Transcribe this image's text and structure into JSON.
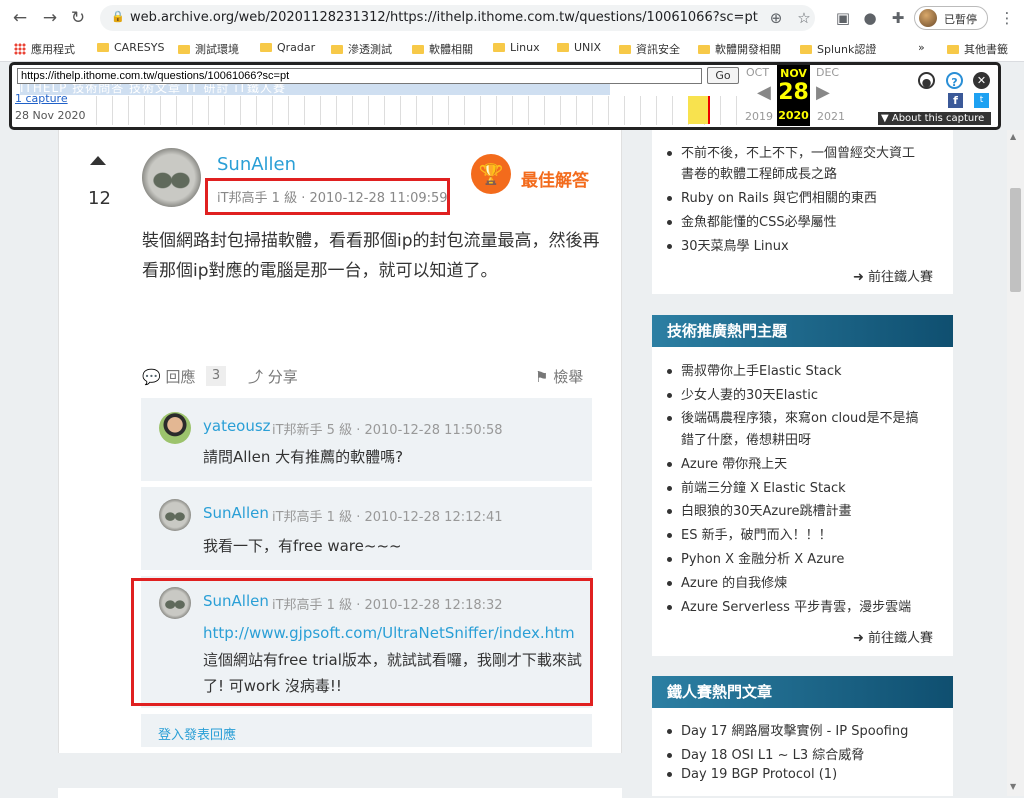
{
  "browser": {
    "url": "web.archive.org/web/20201128231312/https://ithelp.ithome.com.tw/questions/10061066?sc=pt",
    "profile_label": "已暫停"
  },
  "bookmarks": [
    "應用程式",
    "CARESYS",
    "測試環境",
    "Qradar",
    "滲透測試",
    "軟體相關",
    "Linux",
    "UNIX",
    "資訊安全",
    "軟體開發相關",
    "Splunk認證"
  ],
  "bookmarks_overflow": "»",
  "bookmarks_other": "其他書籤",
  "wayback": {
    "url_input": "https://ithelp.ithome.com.tw/questions/10061066?sc=pt",
    "go_label": "Go",
    "captures_link": "1 capture",
    "capture_date": "28 Nov 2020",
    "prev_month": "OCT",
    "cur_month": "NOV",
    "next_month": "DEC",
    "cur_day": "28",
    "prev_year": "2019",
    "cur_year": "2020",
    "next_year": "2021",
    "about_label": "▼ About this capture",
    "ghost_nav": "ITHELP  技術問答  技術文章  IT 研討  iT鐵人賽"
  },
  "answer": {
    "votes": "12",
    "author": "SunAllen",
    "meta": "iT邦高手 1 級 · 2010-12-28 11:09:59",
    "best_label": "最佳解答",
    "body": "裝個網路封包掃描軟體，看看那個ip的封包流量最高，然後再看那個ip對應的電腦是那一台，就可以知道了。",
    "reply_label": "回應",
    "reply_count": "3",
    "share_label": "分享",
    "report_label": "檢舉"
  },
  "comments": [
    {
      "author": "yateousz",
      "meta": "iT邦新手 5 級 · 2010-12-28 11:50:58",
      "body": "請問Allen 大有推薦的軟體嗎?"
    },
    {
      "author": "SunAllen",
      "meta": "iT邦高手 1 級 · 2010-12-28 12:12:41",
      "body": "我看一下，有free ware~~~"
    },
    {
      "author": "SunAllen",
      "meta": "iT邦高手 1 級 · 2010-12-28 12:18:32",
      "link": "http://www.gjpsoft.com/UltraNetSniffer/index.htm",
      "body": "這個網站有free trial版本，就試試看囉，我剛才下載來試了! 可work 沒病毒!!"
    }
  ],
  "login_reply": "登入發表回應",
  "sidebar": {
    "top_items": [
      "不前不後，不上不下，一個曾經交大資工",
      "書卷的軟體工程師成長之路",
      "Ruby on Rails 與它們相關的東西",
      "金魚都能懂的CSS必學屬性",
      "30天菜鳥學 Linux"
    ],
    "top_more": "前往鐵人賽",
    "tech_title": "技術推廣熱門主題",
    "tech_items": [
      "需叔帶你上手Elastic Stack",
      "少女人妻的30天Elastic",
      "後端碼農程序猿，來寫on cloud是不是搞",
      "錯了什麼，倦想耕田呀",
      "Azure 帶你飛上天",
      "前端三分鐘 X Elastic Stack",
      "白眼狼的30天Azure跳槽計畫",
      "ES 新手，破門而入！！！",
      "Pyhon X 金融分析 X Azure",
      "Azure 的自我修煉",
      "Azure Serverless 平步青雲，漫步雲端"
    ],
    "tech_more": "前往鐵人賽",
    "ironman_title": "鐵人賽熱門文章",
    "ironman_items": [
      "Day 17 網路層攻擊實例 - IP Spoofing",
      "Day 18 OSI L1 ~ L3 綜合威脅",
      "Day 19 BGP Protocol (1)"
    ]
  }
}
